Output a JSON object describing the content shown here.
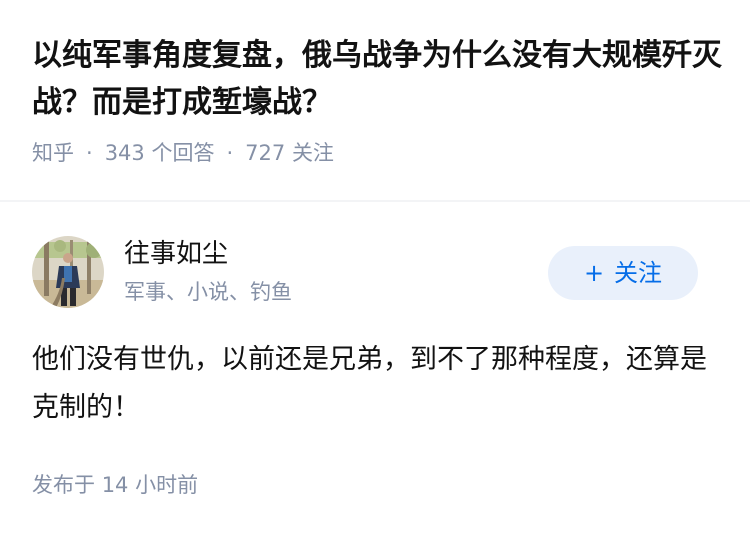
{
  "question": {
    "title": "以纯军事角度复盘，俄乌战争为什么没有大规模歼灭战？而是打成堑壕战？",
    "source": "知乎",
    "separator": "·",
    "answer_count": "343",
    "answer_label": "个回答",
    "follower_count": "727",
    "follower_label": "关注"
  },
  "answer": {
    "author_name": "往事如尘",
    "author_bio": "军事、小说、钓鱼",
    "follow_icon": "+",
    "follow_label": "关注",
    "text": "他们没有世仇，以前还是兄弟，到不了那种程度，还算是克制的！",
    "time_prefix": "发布于",
    "time_value": "14 小时前"
  },
  "colors": {
    "primary_text": "#121212",
    "secondary_text": "#8590a6",
    "accent": "#056de8",
    "follow_bg": "#e9f0fb",
    "divider": "#f3f4f6"
  }
}
